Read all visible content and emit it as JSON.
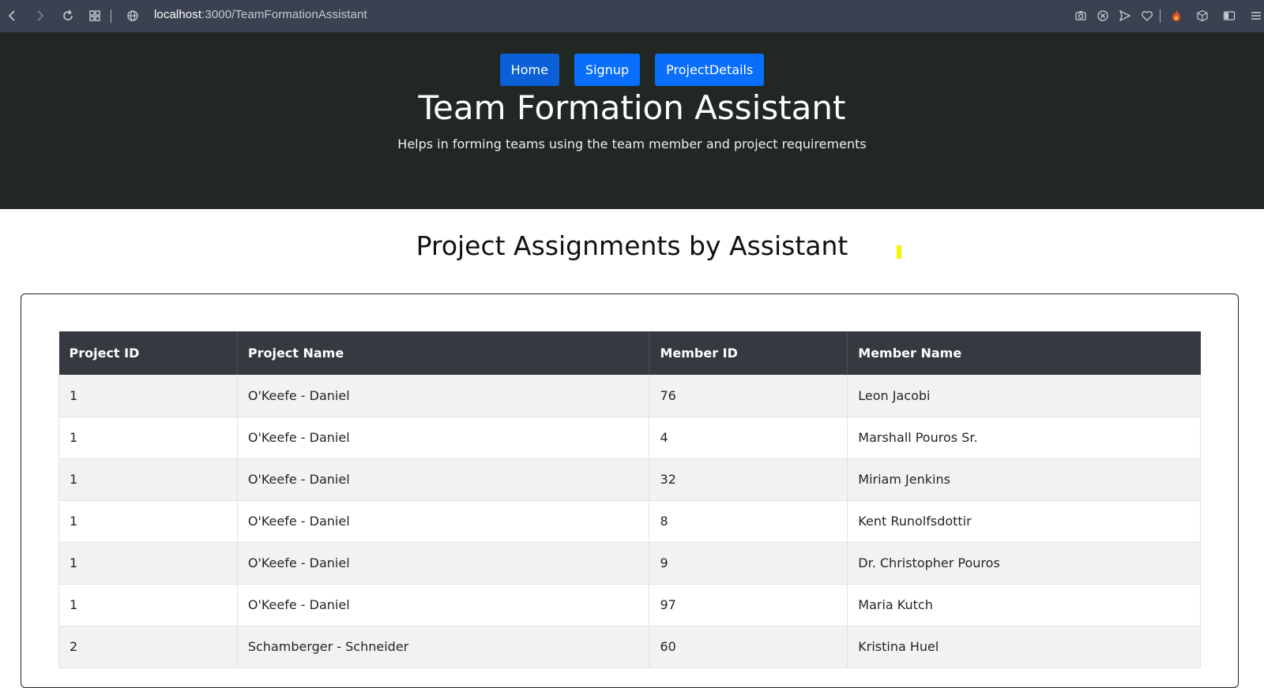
{
  "browser": {
    "url_host": "localhost",
    "url_path": ":3000/TeamFormationAssistant"
  },
  "nav": {
    "links": [
      "Home",
      "Signup",
      "ProjectDetails"
    ]
  },
  "hero": {
    "title": "Team Formation Assistant",
    "subtitle": "Helps in forming teams using the team member and project requirements"
  },
  "main": {
    "section_title": "Project Assignments by Assistant"
  },
  "table": {
    "columns": [
      "Project ID",
      "Project Name",
      "Member ID",
      "Member Name"
    ],
    "rows": [
      [
        "1",
        "O'Keefe - Daniel",
        "76",
        "Leon Jacobi"
      ],
      [
        "1",
        "O'Keefe - Daniel",
        "4",
        "Marshall Pouros Sr."
      ],
      [
        "1",
        "O'Keefe - Daniel",
        "32",
        "Miriam Jenkins"
      ],
      [
        "1",
        "O'Keefe - Daniel",
        "8",
        "Kent Runolfsdottir"
      ],
      [
        "1",
        "O'Keefe - Daniel",
        "9",
        "Dr. Christopher Pouros"
      ],
      [
        "1",
        "O'Keefe - Daniel",
        "97",
        "Maria Kutch"
      ],
      [
        "2",
        "Schamberger - Schneider",
        "60",
        "Kristina Huel"
      ]
    ]
  },
  "colors": {
    "browser_bar": "#3a4150",
    "hero_bg": "#212722",
    "button": "#0a6efd",
    "table_header": "#343a40",
    "cursor_highlight": "#f4f400"
  }
}
